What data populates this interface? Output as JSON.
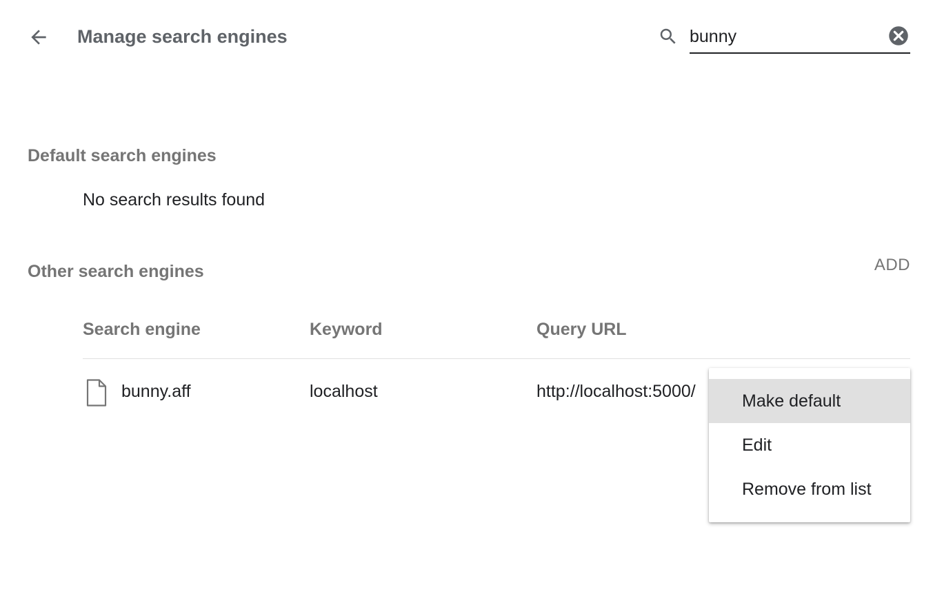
{
  "header": {
    "title": "Manage search engines",
    "back_icon": "arrow-back-icon",
    "search": {
      "icon": "search-icon",
      "value": "bunny",
      "clear_icon": "clear-icon"
    }
  },
  "default_section": {
    "title": "Default search engines",
    "empty_message": "No search results found"
  },
  "other_section": {
    "title": "Other search engines",
    "add_label": "ADD",
    "columns": {
      "engine": "Search engine",
      "keyword": "Keyword",
      "url": "Query URL"
    },
    "rows": [
      {
        "icon": "page-icon",
        "engine": "bunny.aff",
        "keyword": "localhost",
        "url": "http://localhost:5000/"
      }
    ]
  },
  "context_menu": {
    "items": [
      {
        "label": "Make default",
        "selected": true
      },
      {
        "label": "Edit",
        "selected": false
      },
      {
        "label": "Remove from list",
        "selected": false
      }
    ]
  },
  "colors": {
    "title_gray": "#5f6368",
    "section_gray": "#757575",
    "text": "#202124",
    "menu_highlight": "#e0e0e0",
    "divider": "#e0e0e0"
  }
}
